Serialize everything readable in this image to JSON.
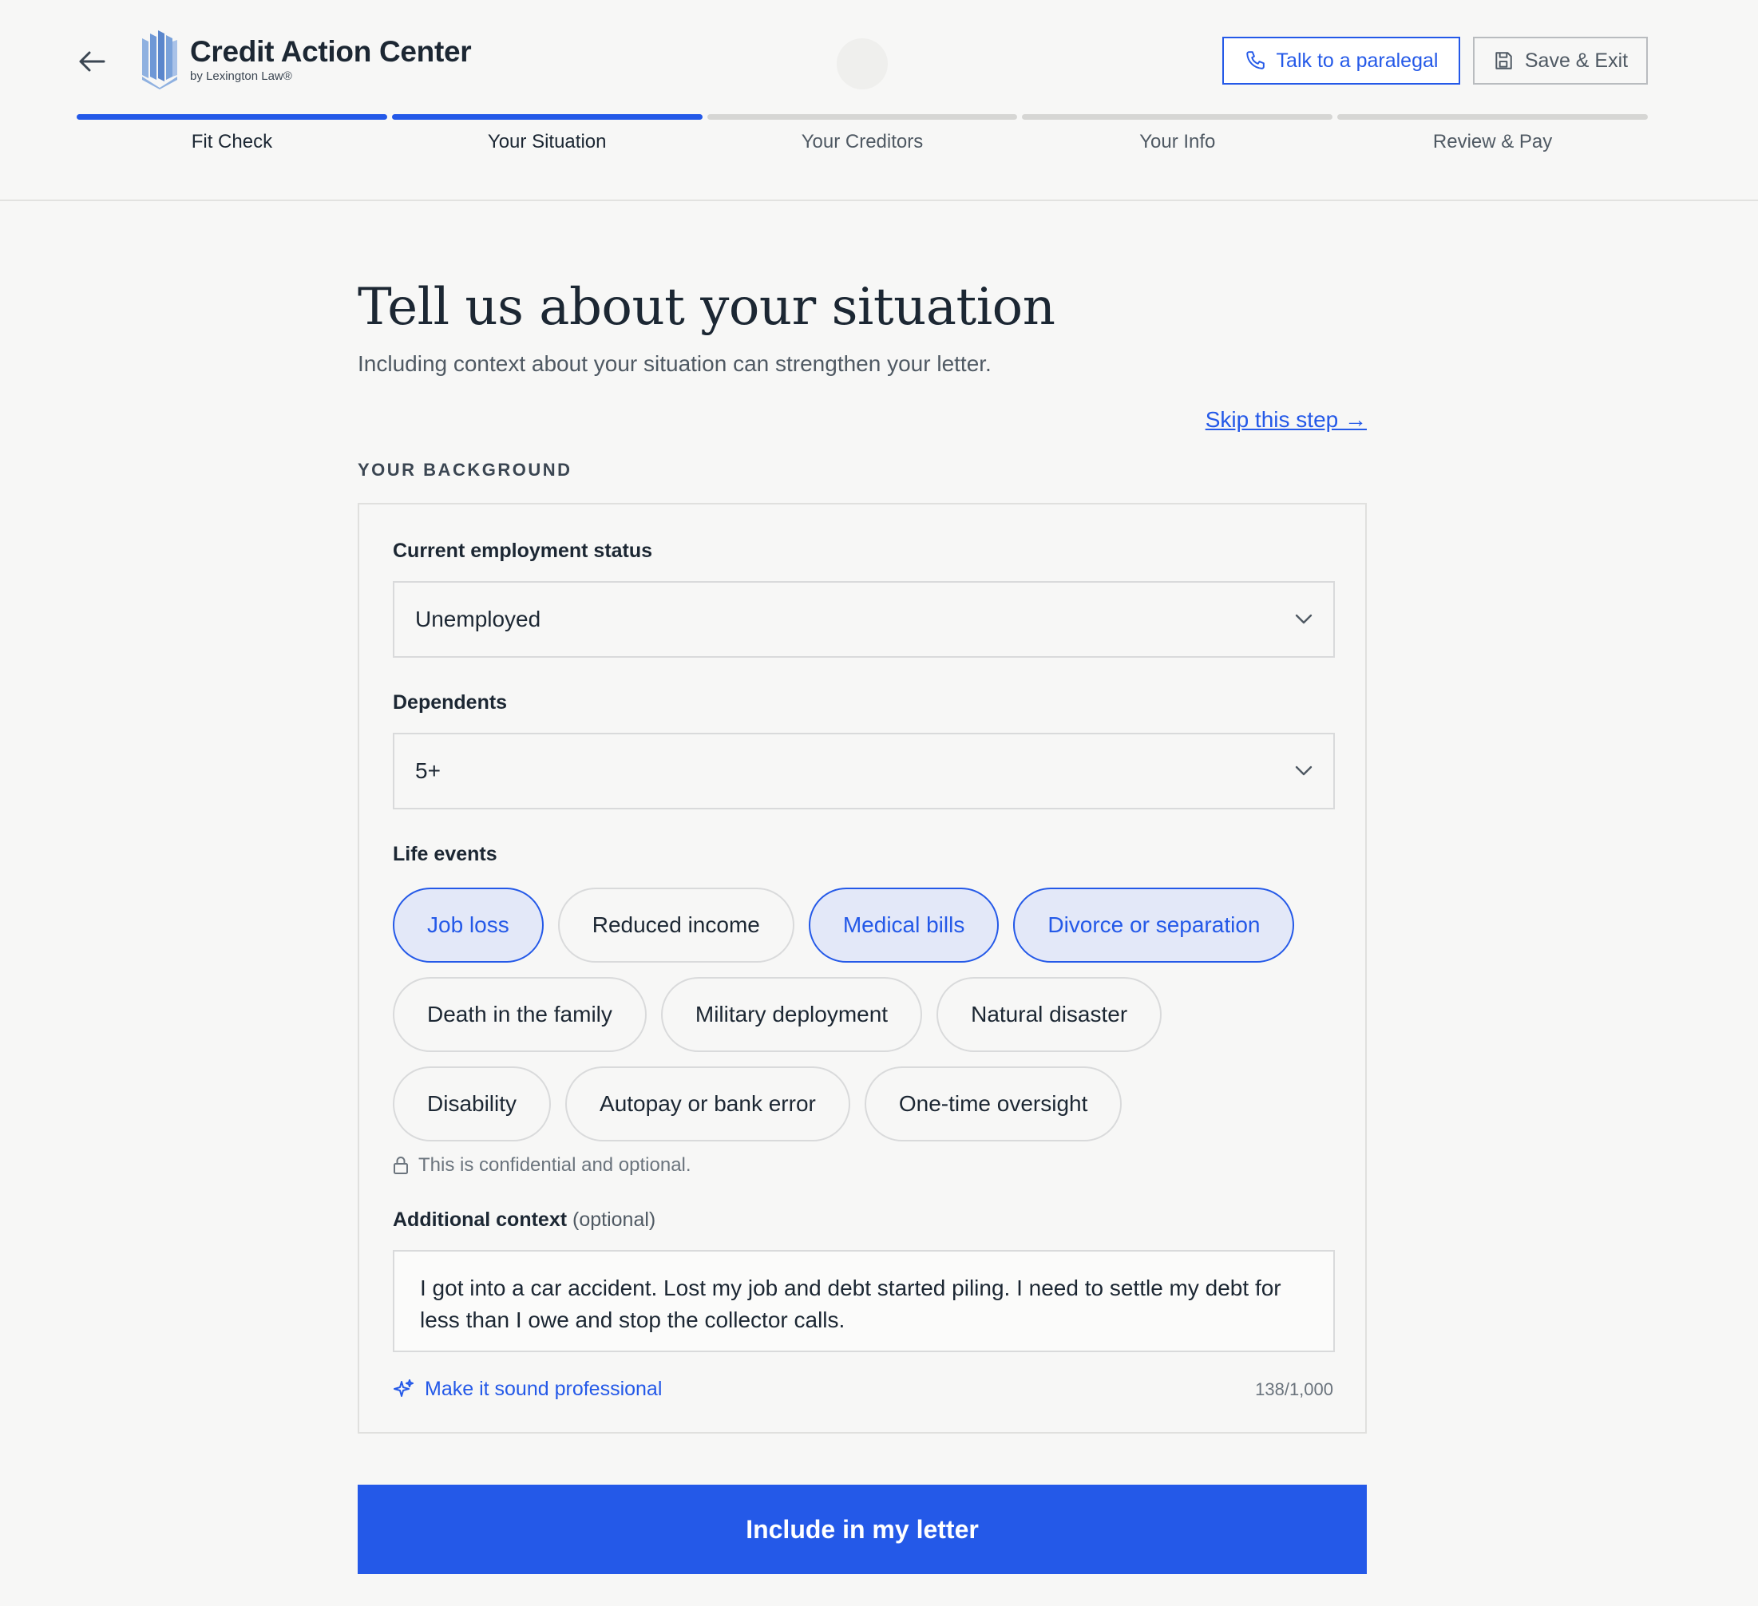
{
  "app": {
    "title": "Credit Action Center",
    "subtitle": "by Lexington Law®"
  },
  "header": {
    "paralegal_label": "Talk to a paralegal",
    "save_label": "Save & Exit"
  },
  "steps": [
    {
      "label": "Fit Check",
      "done": true
    },
    {
      "label": "Your Situation",
      "done": true
    },
    {
      "label": "Your Creditors",
      "done": false
    },
    {
      "label": "Your Info",
      "done": false
    },
    {
      "label": "Review & Pay",
      "done": false
    }
  ],
  "page": {
    "title": "Tell us about your situation",
    "subtitle": "Including context about your situation can strengthen your letter.",
    "skip_label": "Skip this step →",
    "section_label": "YOUR BACKGROUND"
  },
  "form": {
    "employment": {
      "label": "Current employment status",
      "value": "Unemployed"
    },
    "dependents": {
      "label": "Dependents",
      "value": "5+"
    },
    "life_events": {
      "label": "Life events",
      "chips": [
        {
          "label": "Job loss",
          "selected": true
        },
        {
          "label": "Reduced income",
          "selected": false
        },
        {
          "label": "Medical bills",
          "selected": true
        },
        {
          "label": "Divorce or separation",
          "selected": true
        },
        {
          "label": "Death in the family",
          "selected": false
        },
        {
          "label": "Military deployment",
          "selected": false
        },
        {
          "label": "Natural disaster",
          "selected": false
        },
        {
          "label": "Disability",
          "selected": false
        },
        {
          "label": "Autopay or bank error",
          "selected": false
        },
        {
          "label": "One-time oversight",
          "selected": false
        }
      ],
      "note": "This is confidential and optional."
    },
    "context": {
      "label": "Additional context",
      "label_suffix": "(optional)",
      "value": "I got into a car accident. Lost my job and debt started piling. I need to settle my debt for less than I owe and stop the collector calls.",
      "ai_label": "Make it sound professional",
      "char_count": "138/1,000"
    },
    "submit_label": "Include in my letter"
  },
  "colors": {
    "accent": "#2459e8",
    "selected_bg": "#e3e8f8",
    "page_bg": "#f7f7f6"
  }
}
